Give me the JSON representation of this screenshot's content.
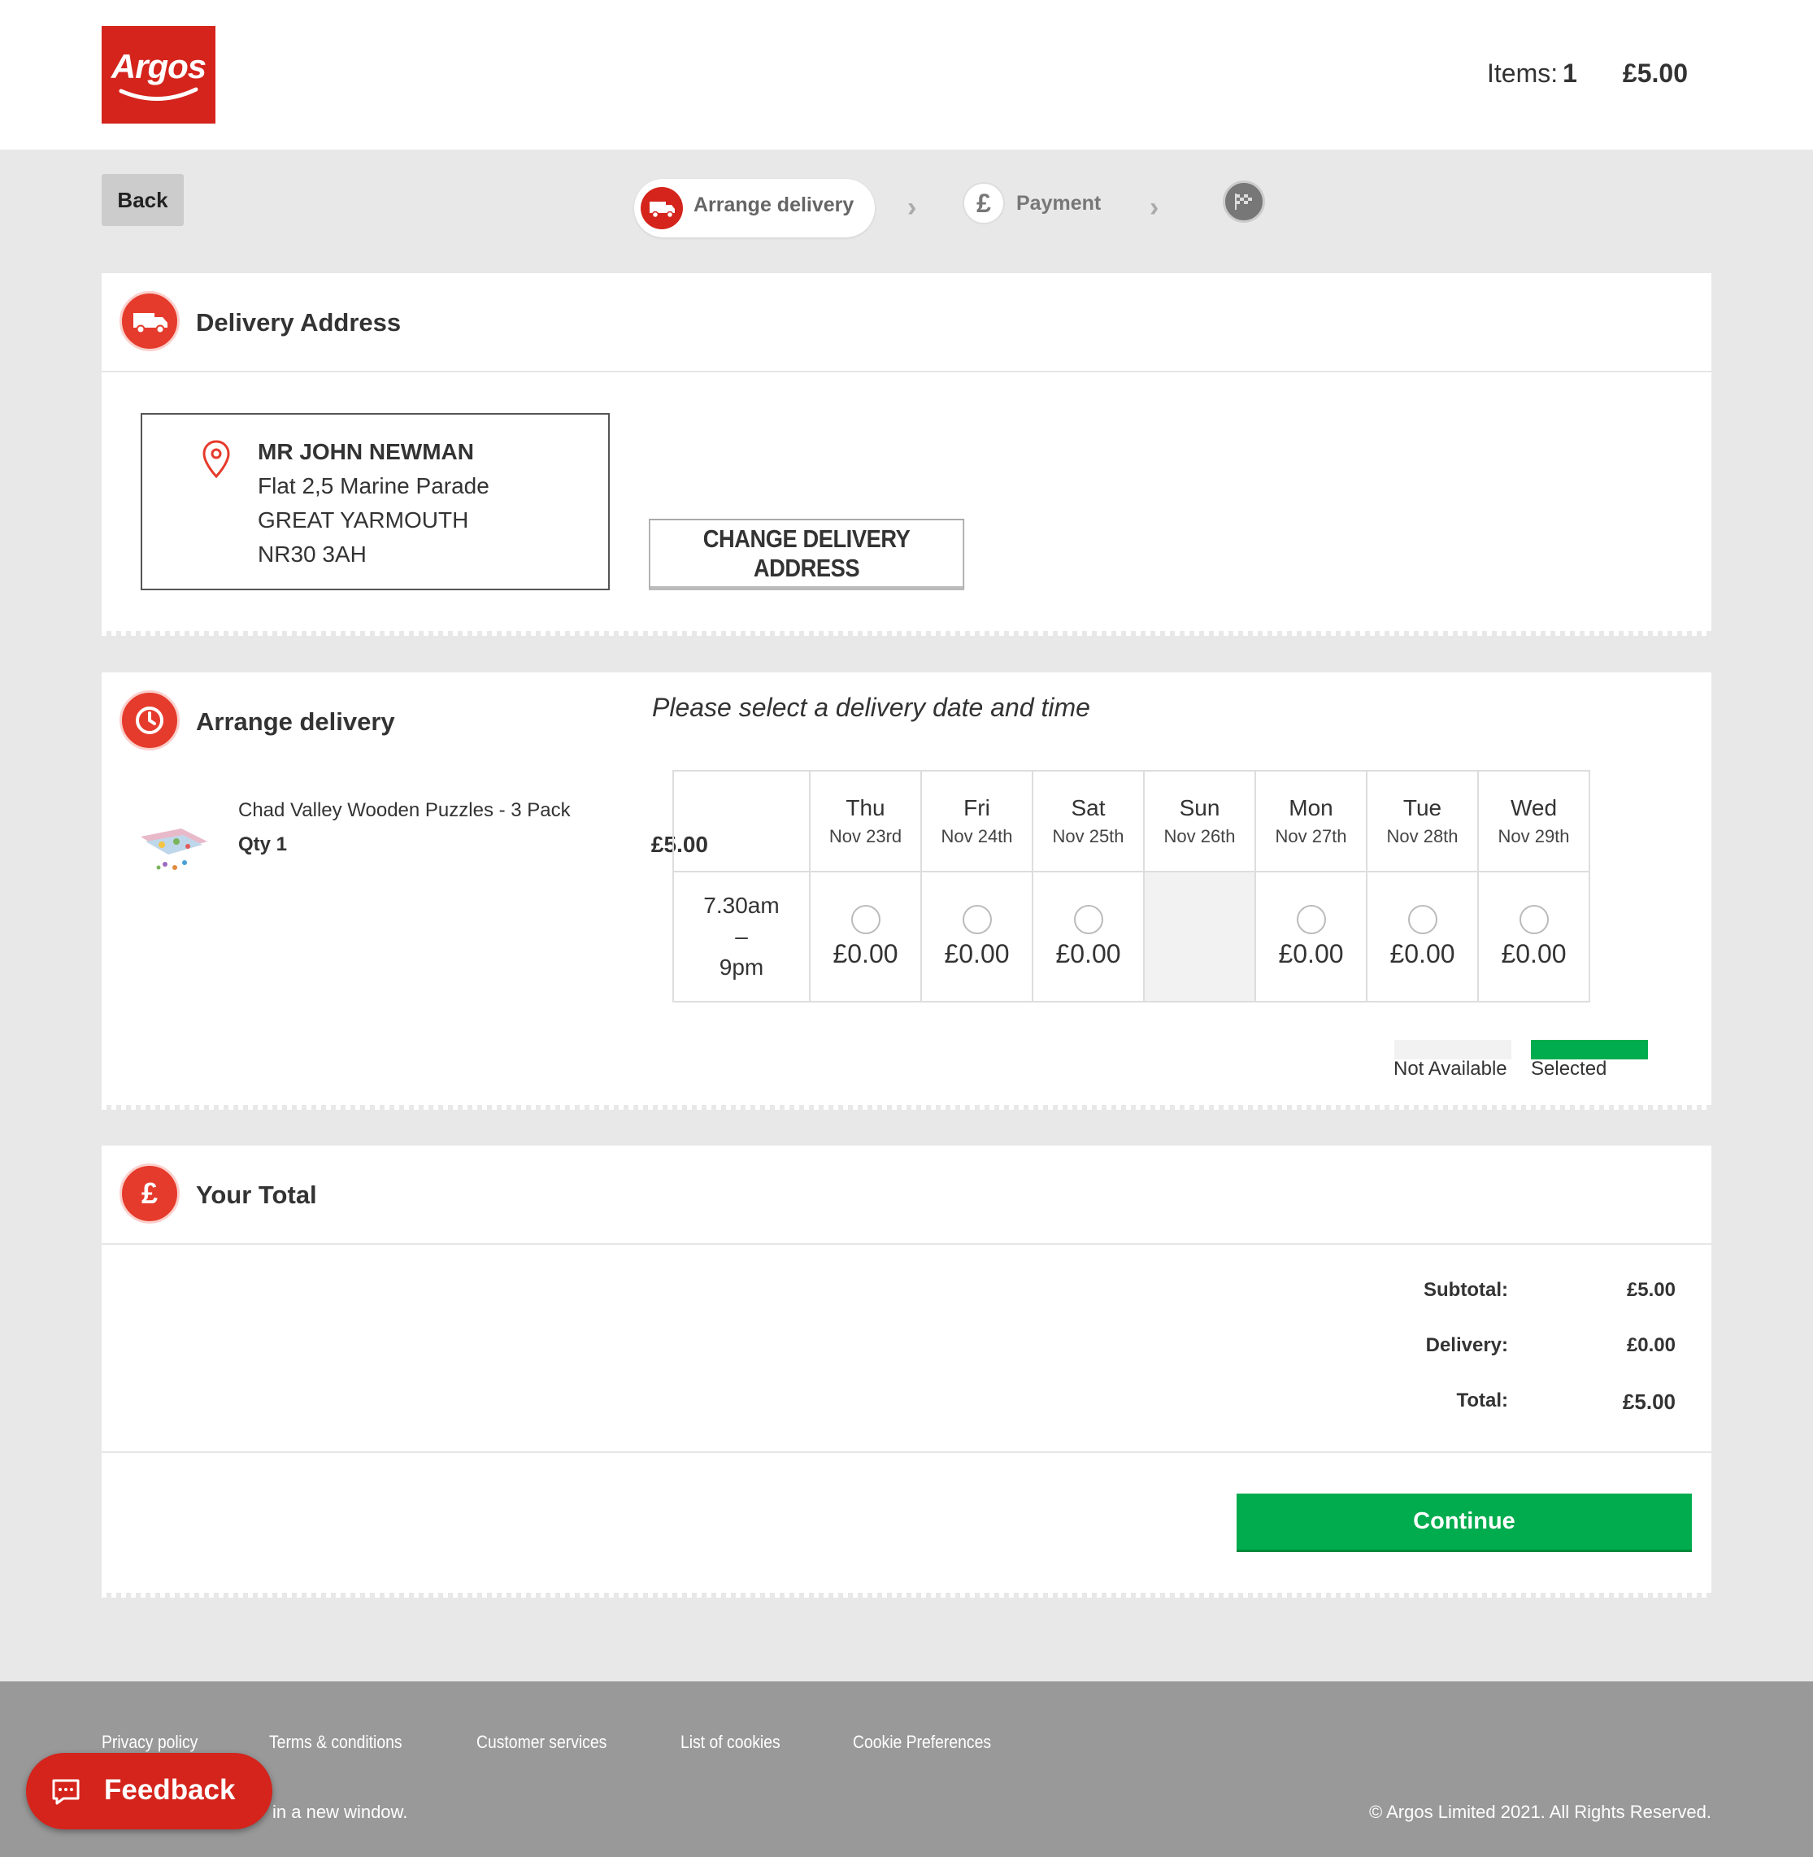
{
  "brand": {
    "name": "Argos",
    "red": "#d4241c",
    "green": "#00ac4e"
  },
  "basket": {
    "items_label": "Items:",
    "items_count": "1",
    "total": "£5.00"
  },
  "nav": {
    "back_label": "Back"
  },
  "progress": {
    "steps": [
      {
        "label": "Arrange delivery",
        "icon": "truck-icon",
        "state": "active"
      },
      {
        "label": "Payment",
        "icon": "pound-icon",
        "state": "upcoming"
      },
      {
        "label": "",
        "icon": "finish-flag-icon",
        "state": "upcoming"
      }
    ],
    "separator_icon": "chevron-right-icon"
  },
  "delivery_address": {
    "title": "Delivery Address",
    "name": "MR JOHN NEWMAN",
    "line1": "Flat 2,5 Marine Parade",
    "town": "GREAT YARMOUTH",
    "postcode": "NR30 3AH",
    "change_label": "CHANGE DELIVERY ADDRESS"
  },
  "arrange_delivery": {
    "title": "Arrange delivery",
    "prompt": "Please select a delivery date and time",
    "product": {
      "name": "Chad Valley Wooden Puzzles - 3 Pack",
      "qty": "Qty 1",
      "price": "£5.00"
    },
    "slot": {
      "start": "7.30am",
      "dash": "–",
      "end": "9pm"
    },
    "days": [
      {
        "day": "Thu",
        "date": "Nov 23rd",
        "price": "£0.00",
        "available": true
      },
      {
        "day": "Fri",
        "date": "Nov 24th",
        "price": "£0.00",
        "available": true
      },
      {
        "day": "Sat",
        "date": "Nov 25th",
        "price": "£0.00",
        "available": true
      },
      {
        "day": "Sun",
        "date": "Nov 26th",
        "price": "",
        "available": false
      },
      {
        "day": "Mon",
        "date": "Nov 27th",
        "price": "£0.00",
        "available": true
      },
      {
        "day": "Tue",
        "date": "Nov 28th",
        "price": "£0.00",
        "available": true
      },
      {
        "day": "Wed",
        "date": "Nov 29th",
        "price": "£0.00",
        "available": true
      }
    ],
    "legend": {
      "not_available": "Not Available",
      "selected": "Selected"
    }
  },
  "your_total": {
    "title": "Your Total",
    "subtotal_label": "Subtotal:",
    "subtotal": "£5.00",
    "delivery_label": "Delivery:",
    "delivery": "£0.00",
    "total_label": "Total:",
    "total": "£5.00",
    "continue_label": "Continue"
  },
  "footer": {
    "links": [
      "Privacy policy",
      "Terms & conditions",
      "Customer services",
      "List of cookies",
      "Cookie Preferences"
    ],
    "note": "in a new window.",
    "copyright": "© Argos Limited 2021. All Rights Reserved."
  },
  "feedback": {
    "label": "Feedback"
  }
}
